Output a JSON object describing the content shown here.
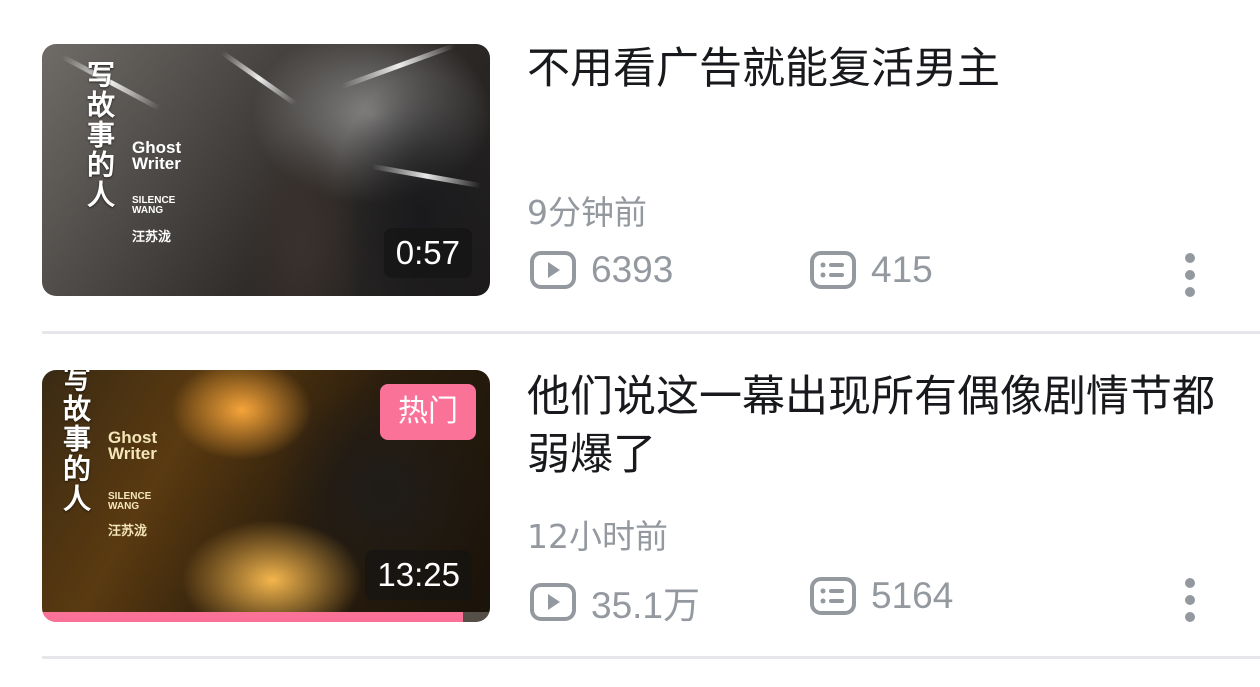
{
  "videos": [
    {
      "title": "不用看广告就能复活男主",
      "time_ago": "9分钟前",
      "duration": "0:57",
      "plays": "6393",
      "comments": "415",
      "badge": "",
      "thumbnail": {
        "title_cn": "写故事的人",
        "title_en_1": "Ghost",
        "title_en_2": "Writer",
        "artist_en_1": "SILENCE",
        "artist_en_2": "WANG",
        "artist_cn": "汪苏泷"
      }
    },
    {
      "title": "他们说这一幕出现所有偶像剧情节都弱爆了",
      "time_ago": "12小时前",
      "duration": "13:25",
      "plays": "35.1万",
      "comments": "5164",
      "badge": "热门",
      "watch_progress": 0.94,
      "thumbnail": {
        "title_cn": "写故事的人",
        "title_en_1": "Ghost",
        "title_en_2": "Writer",
        "artist_en_1": "SILENCE",
        "artist_en_2": "WANG",
        "artist_cn": "汪苏泷"
      }
    }
  ],
  "icons": {
    "play_count": "play-count-icon",
    "comment_count": "comment-count-icon",
    "more": "more-vertical-icon"
  },
  "colors": {
    "accent_pink": "#fb7299",
    "meta_gray": "#9499a0",
    "title_text": "#18191c",
    "divider": "#e6e7ea"
  }
}
